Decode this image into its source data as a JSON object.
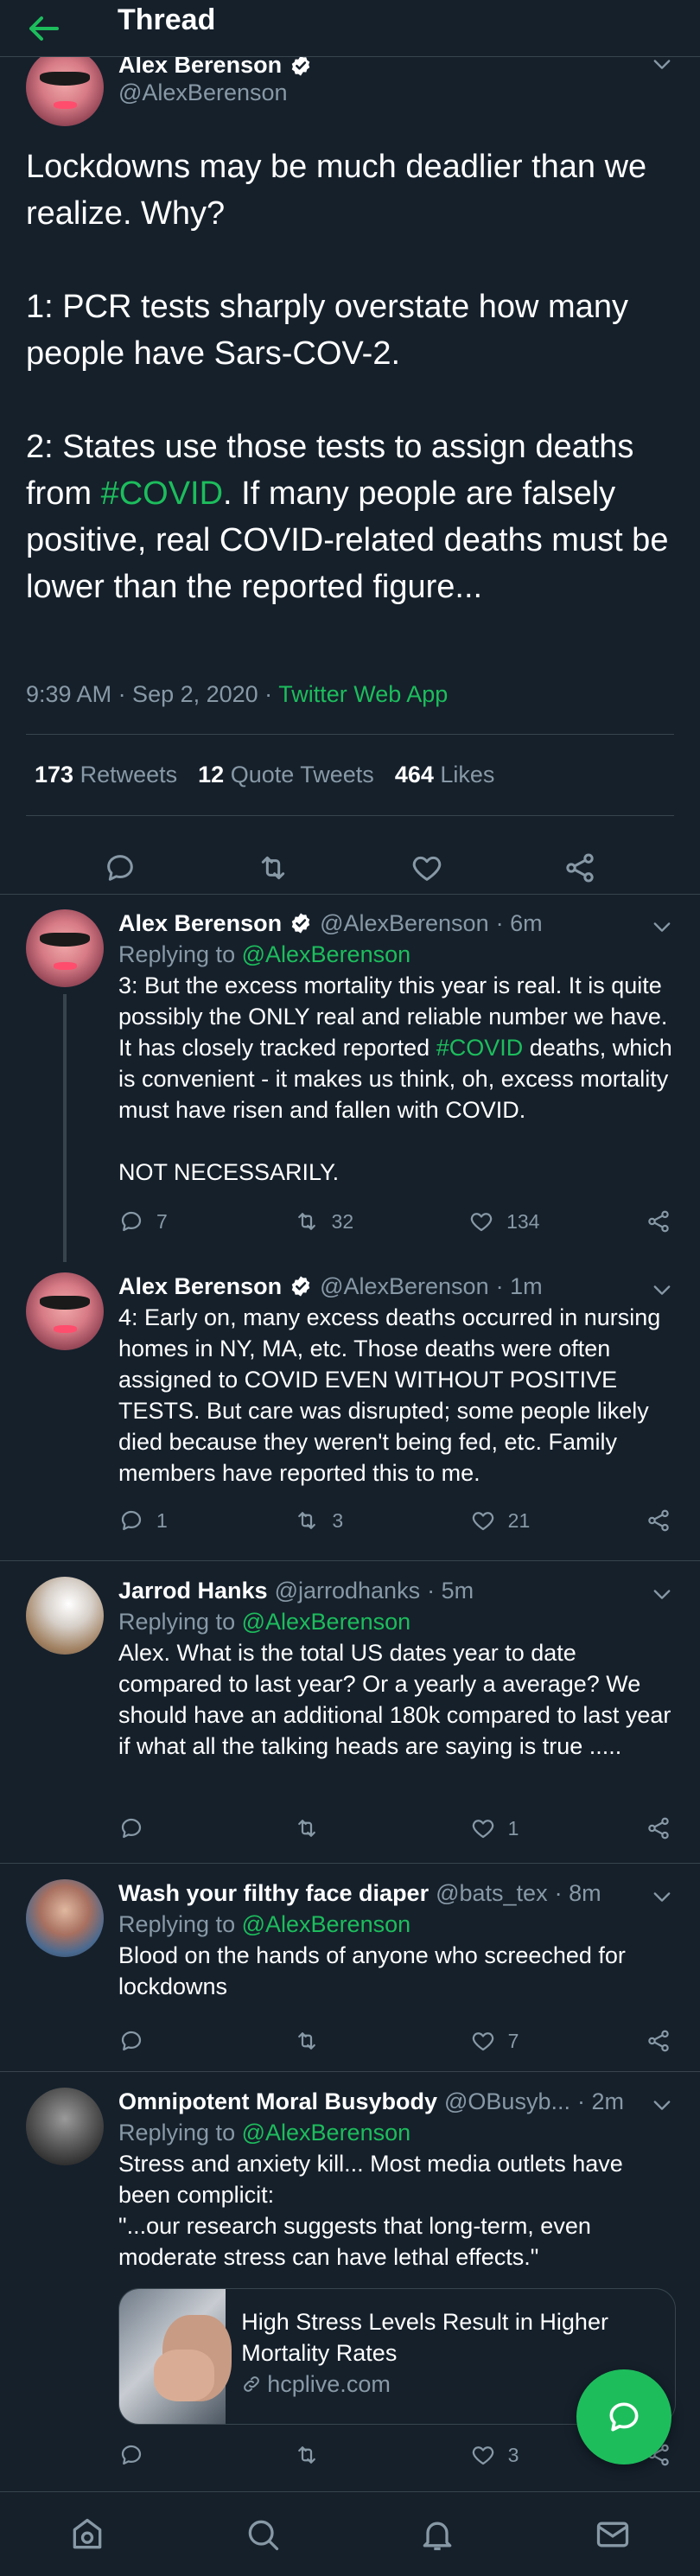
{
  "header": {
    "title": "Thread"
  },
  "main_tweet": {
    "author_name": "Alex Berenson",
    "author_handle": "@AlexBerenson",
    "text_part1": "Lockdowns may be much deadlier than we realize. Why?\n\n1: PCR tests sharply overstate how many people have Sars-COV-2.\n\n2: States use those tests to assign deaths from ",
    "hashtag": "#COVID",
    "text_part2": ". If many people are falsely positive, real COVID-related deaths must be lower than the reported figure...",
    "time": "9:39 AM · Sep 2, 2020 · ",
    "source": "Twitter Web App",
    "stats": {
      "retweets_count": "173",
      "retweets_label": "Retweets",
      "quotes_count": "12",
      "quotes_label": "Quote Tweets",
      "likes_count": "464",
      "likes_label": "Likes"
    }
  },
  "replies": [
    {
      "name": "Alex Berenson",
      "handle": "@AlexBerenson",
      "time": "· 6m",
      "replying_label": "Replying to",
      "replying_to": "@AlexBerenson",
      "text_part1": "3: But the excess mortality this year is real. It is quite possibly the ONLY real and reliable number we have. It has closely tracked reported ",
      "hashtag": "#COVID",
      "text_part2": " deaths, which is convenient - it makes us think, oh, excess mortality must have risen and fallen with COVID.\n\nNOT NECESSARILY.",
      "reply_count": "7",
      "retweet_count": "32",
      "like_count": "134"
    },
    {
      "name": "Alex Berenson",
      "handle": "@AlexBerenson",
      "time": "· 1m",
      "text": "4: Early on, many excess deaths occurred in nursing homes in NY, MA, etc. Those deaths were often assigned to COVID EVEN WITHOUT POSITIVE TESTS. But care was disrupted; some people likely died because they weren't being fed, etc. Family members have reported this to me.",
      "reply_count": "1",
      "retweet_count": "3",
      "like_count": "21"
    },
    {
      "name": "Jarrod Hanks",
      "handle": "@jarrodhanks",
      "time": "· 5m",
      "replying_label": "Replying to",
      "replying_to": "@AlexBerenson",
      "text": "Alex. What is the total US dates year to date compared to last year? Or a yearly a average? We should have an additional 180k compared to last year if what all the talking heads are saying is true .....",
      "like_count": "1"
    },
    {
      "name": "Wash your filthy face diaper",
      "handle": "@bats_tex",
      "time": "· 8m",
      "replying_label": "Replying to",
      "replying_to": "@AlexBerenson",
      "text": "Blood on the hands of anyone who screeched for lockdowns",
      "like_count": "7"
    },
    {
      "name": "Omnipotent Moral Busybody",
      "handle": "@OBusyb...",
      "time": "· 2m",
      "replying_label": "Replying to",
      "replying_to": "@AlexBerenson",
      "text": "Stress and anxiety kill... Most media outlets have been complicit:\n\"...our research suggests that long-term, even moderate stress can have lethal effects.\"",
      "link_title": "High Stress Levels Result in Higher Mortality Rates",
      "link_domain": "hcplive.com",
      "like_count": "3"
    }
  ],
  "colors": {
    "background": "#15202b",
    "accent": "#1dbd5c",
    "muted": "#8899a6",
    "divider": "#38444d"
  },
  "icons": [
    "back-arrow-icon",
    "verified-badge-icon",
    "chevron-down-icon",
    "reply-icon",
    "retweet-icon",
    "like-icon",
    "share-icon",
    "link-icon",
    "compose-icon",
    "home-icon",
    "search-icon",
    "notifications-icon",
    "messages-icon"
  ]
}
